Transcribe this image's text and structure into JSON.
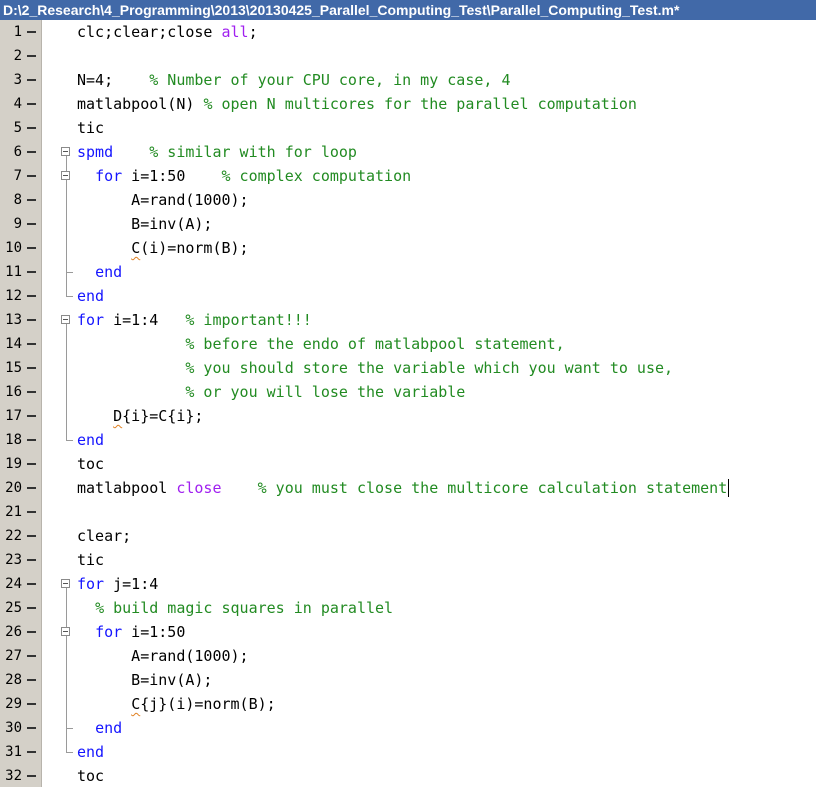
{
  "window": {
    "title": "D:\\2_Research\\4_Programming\\2013\\20130425_Parallel_Computing_Test\\Parallel_Computing_Test.m*"
  },
  "colors": {
    "keyword": "#1515ff",
    "comment": "#228b22",
    "string": "#a020f0",
    "title_bar": "#4169a8",
    "gutter": "#d4d0c8"
  },
  "editor": {
    "lines": [
      {
        "num": "1",
        "tokens": [
          [
            "t",
            "clc;clear;close "
          ],
          [
            "s",
            "all"
          ],
          [
            "t",
            ";"
          ]
        ]
      },
      {
        "num": "2",
        "tokens": []
      },
      {
        "num": "3",
        "tokens": [
          [
            "t",
            "N=4;    "
          ],
          [
            "c",
            "% Number of your CPU core, in my case, 4"
          ]
        ]
      },
      {
        "num": "4",
        "tokens": [
          [
            "t",
            "matlabpool(N) "
          ],
          [
            "c",
            "% open N multicores for the parallel computation"
          ]
        ]
      },
      {
        "num": "5",
        "tokens": [
          [
            "t",
            "tic"
          ]
        ]
      },
      {
        "num": "6",
        "tokens": [
          [
            "k",
            "spmd"
          ],
          [
            "t",
            "    "
          ],
          [
            "c",
            "% similar with for loop"
          ]
        ]
      },
      {
        "num": "7",
        "tokens": [
          [
            "t",
            "  "
          ],
          [
            "k",
            "for"
          ],
          [
            "t",
            " i=1:50    "
          ],
          [
            "c",
            "% complex computation"
          ]
        ]
      },
      {
        "num": "8",
        "tokens": [
          [
            "t",
            "      A=rand(1000);"
          ]
        ]
      },
      {
        "num": "9",
        "tokens": [
          [
            "t",
            "      B=inv(A);"
          ]
        ]
      },
      {
        "num": "10",
        "tokens": [
          [
            "t",
            "      "
          ],
          [
            "w",
            "C"
          ],
          [
            "t",
            "(i)=norm(B);"
          ]
        ]
      },
      {
        "num": "11",
        "tokens": [
          [
            "t",
            "  "
          ],
          [
            "k",
            "end"
          ]
        ]
      },
      {
        "num": "12",
        "tokens": [
          [
            "k",
            "end"
          ]
        ]
      },
      {
        "num": "13",
        "tokens": [
          [
            "k",
            "for"
          ],
          [
            "t",
            " i=1:4   "
          ],
          [
            "c",
            "% important!!!"
          ]
        ]
      },
      {
        "num": "14",
        "tokens": [
          [
            "t",
            "            "
          ],
          [
            "c",
            "% before the endo of matlabpool statement,"
          ]
        ]
      },
      {
        "num": "15",
        "tokens": [
          [
            "t",
            "            "
          ],
          [
            "c",
            "% you should store the variable which you want to use,"
          ]
        ]
      },
      {
        "num": "16",
        "tokens": [
          [
            "t",
            "            "
          ],
          [
            "c",
            "% or you will lose the variable"
          ]
        ]
      },
      {
        "num": "17",
        "tokens": [
          [
            "t",
            "    "
          ],
          [
            "w",
            "D"
          ],
          [
            "t",
            "{i}=C{i};"
          ]
        ]
      },
      {
        "num": "18",
        "tokens": [
          [
            "k",
            "end"
          ]
        ]
      },
      {
        "num": "19",
        "tokens": [
          [
            "t",
            "toc"
          ]
        ]
      },
      {
        "num": "20",
        "tokens": [
          [
            "t",
            "matlabpool "
          ],
          [
            "s",
            "close"
          ],
          [
            "t",
            "    "
          ],
          [
            "c",
            "% you must close the multicore calculation statement"
          ]
        ]
      },
      {
        "num": "21",
        "tokens": []
      },
      {
        "num": "22",
        "tokens": [
          [
            "t",
            "clear;"
          ]
        ]
      },
      {
        "num": "23",
        "tokens": [
          [
            "t",
            "tic"
          ]
        ]
      },
      {
        "num": "24",
        "tokens": [
          [
            "k",
            "for"
          ],
          [
            "t",
            " j=1:4"
          ]
        ]
      },
      {
        "num": "25",
        "tokens": [
          [
            "t",
            "  "
          ],
          [
            "c",
            "% build magic squares in parallel"
          ]
        ]
      },
      {
        "num": "26",
        "tokens": [
          [
            "t",
            "  "
          ],
          [
            "k",
            "for"
          ],
          [
            "t",
            " i=1:50"
          ]
        ]
      },
      {
        "num": "27",
        "tokens": [
          [
            "t",
            "      A=rand(1000);"
          ]
        ]
      },
      {
        "num": "28",
        "tokens": [
          [
            "t",
            "      B=inv(A);"
          ]
        ]
      },
      {
        "num": "29",
        "tokens": [
          [
            "t",
            "      "
          ],
          [
            "w",
            "C"
          ],
          [
            "t",
            "{j}(i)=norm(B);"
          ]
        ]
      },
      {
        "num": "30",
        "tokens": [
          [
            "t",
            "  "
          ],
          [
            "k",
            "end"
          ]
        ]
      },
      {
        "num": "31",
        "tokens": [
          [
            "k",
            "end"
          ]
        ]
      },
      {
        "num": "32",
        "tokens": [
          [
            "t",
            "toc"
          ]
        ]
      }
    ],
    "fold_starts": [
      6,
      7,
      13,
      24,
      26
    ],
    "fold_blocks": [
      [
        6,
        12
      ],
      [
        7,
        11
      ],
      [
        13,
        18
      ],
      [
        24,
        31
      ],
      [
        26,
        30
      ]
    ],
    "cursor_line": 20
  }
}
